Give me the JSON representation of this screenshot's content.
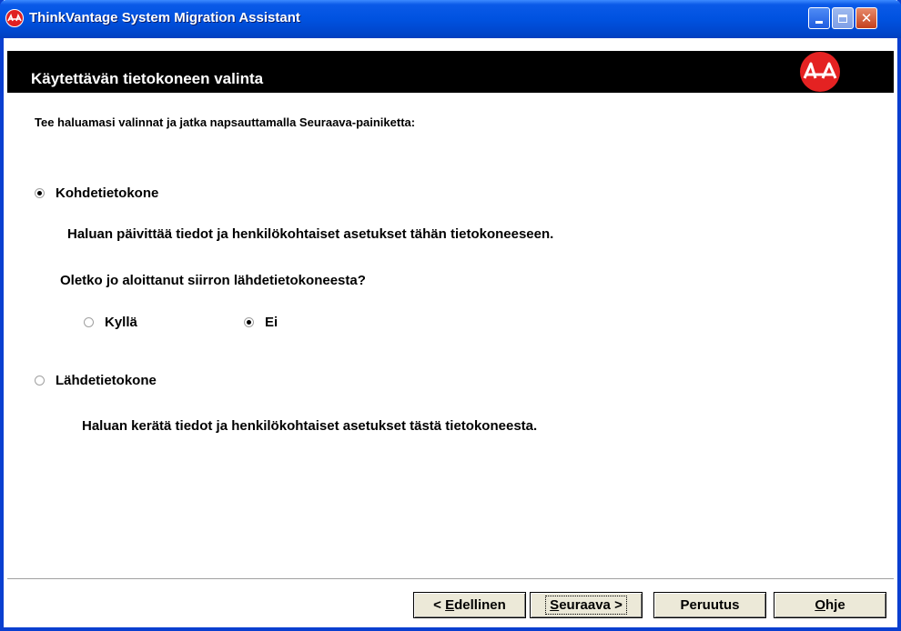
{
  "window": {
    "title": "ThinkVantage System Migration Assistant",
    "title_icon": "smd-logo-icon",
    "accent": "#0a3fd0"
  },
  "header": {
    "title": "Käytettävän tietokoneen valinta",
    "logo": "smd-logo-icon"
  },
  "content": {
    "instruction": "Tee haluamasi valinnat ja jatka napsauttamalla Seuraava-painiketta:",
    "target_option": {
      "label": "Kohdetietokone",
      "selected": true,
      "description": "Haluan päivittää tiedot ja henkilökohtaiset asetukset tähän tietokoneeseen."
    },
    "question": "Oletko jo aloittanut siirron lähdetietokoneesta?",
    "answer_yes": {
      "label": "Kyllä",
      "selected": false
    },
    "answer_no": {
      "label": "Ei",
      "selected": true
    },
    "source_option": {
      "label": "Lähdetietokone",
      "selected": false,
      "description": "Haluan kerätä tiedot ja henkilökohtaiset asetukset tästä tietokoneesta."
    }
  },
  "buttons": {
    "back_prefix": "< ",
    "back_mnemonic": "E",
    "back_rest": "dellinen",
    "next_mnemonic": "S",
    "next_rest": "euraava >",
    "cancel": "Peruutus",
    "help_mnemonic": "O",
    "help_rest": "hje"
  }
}
